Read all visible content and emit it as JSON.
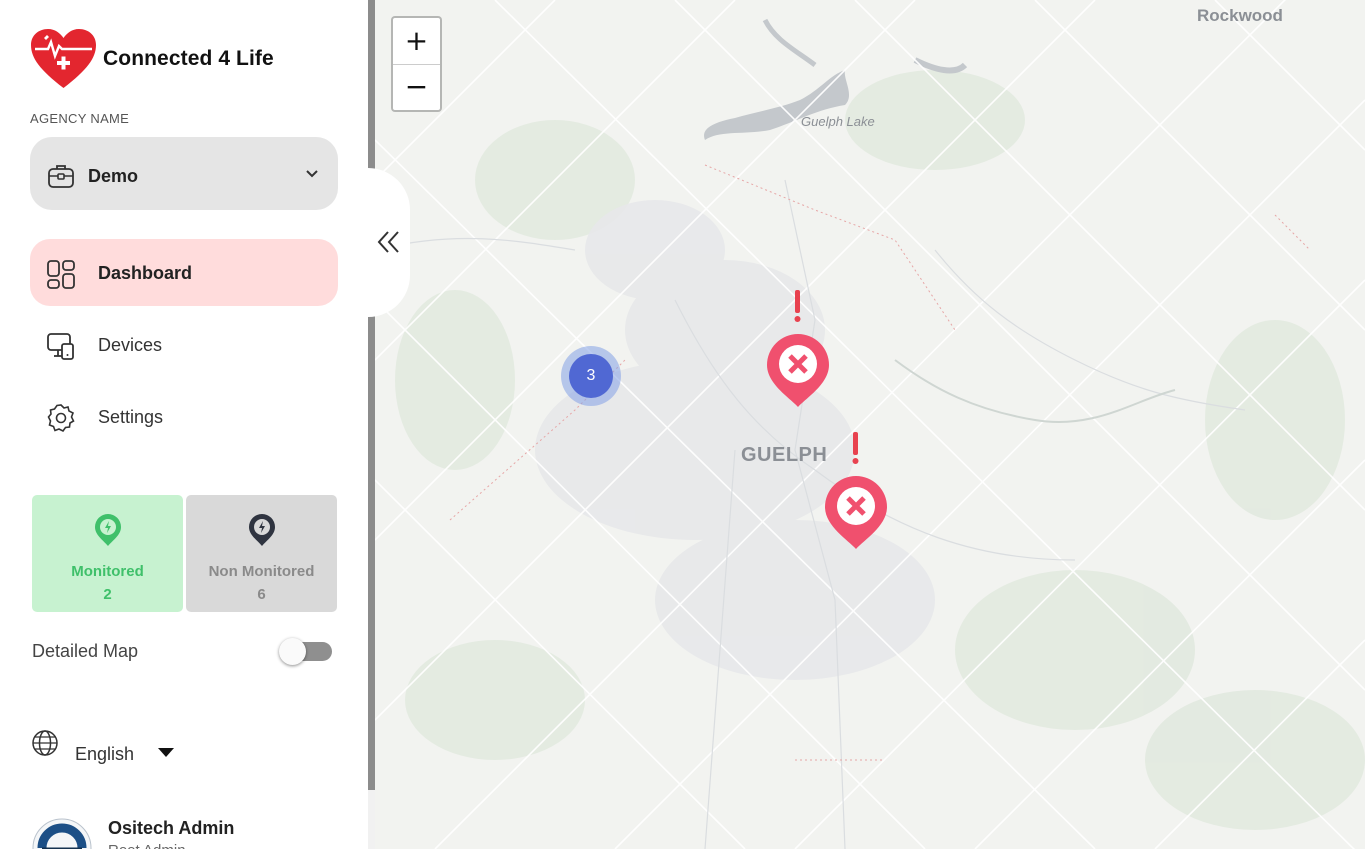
{
  "brand": {
    "name": "Connected 4 Life"
  },
  "agency": {
    "label": "AGENCY NAME",
    "selected": "Demo"
  },
  "nav": [
    {
      "label": "Dashboard",
      "icon": "dashboard-icon",
      "active": true
    },
    {
      "label": "Devices",
      "icon": "devices-icon",
      "active": false
    },
    {
      "label": "Settings",
      "icon": "gear-icon",
      "active": false
    }
  ],
  "cards": {
    "monitored": {
      "label": "Monitored",
      "count": "2"
    },
    "non_monitored": {
      "label": "Non Monitored",
      "count": "6"
    }
  },
  "detailed_map": {
    "label": "Detailed Map",
    "enabled": false
  },
  "language": {
    "selected": "English"
  },
  "user": {
    "name": "Ositech Admin",
    "role": "Root Admin"
  },
  "map": {
    "zoom_in": "+",
    "zoom_out": "−",
    "labels": {
      "city": "GUELPH",
      "lake": "Guelph Lake",
      "town": "Rockwood"
    },
    "cluster_count": "3",
    "alert_markers": 2
  },
  "colors": {
    "accent_active_bg": "#ffdcdc",
    "monitored_bg": "#c7f2d0",
    "monitored_text": "#3fc06a",
    "alert_marker": "#f0506e",
    "cluster": "#5068d3"
  }
}
